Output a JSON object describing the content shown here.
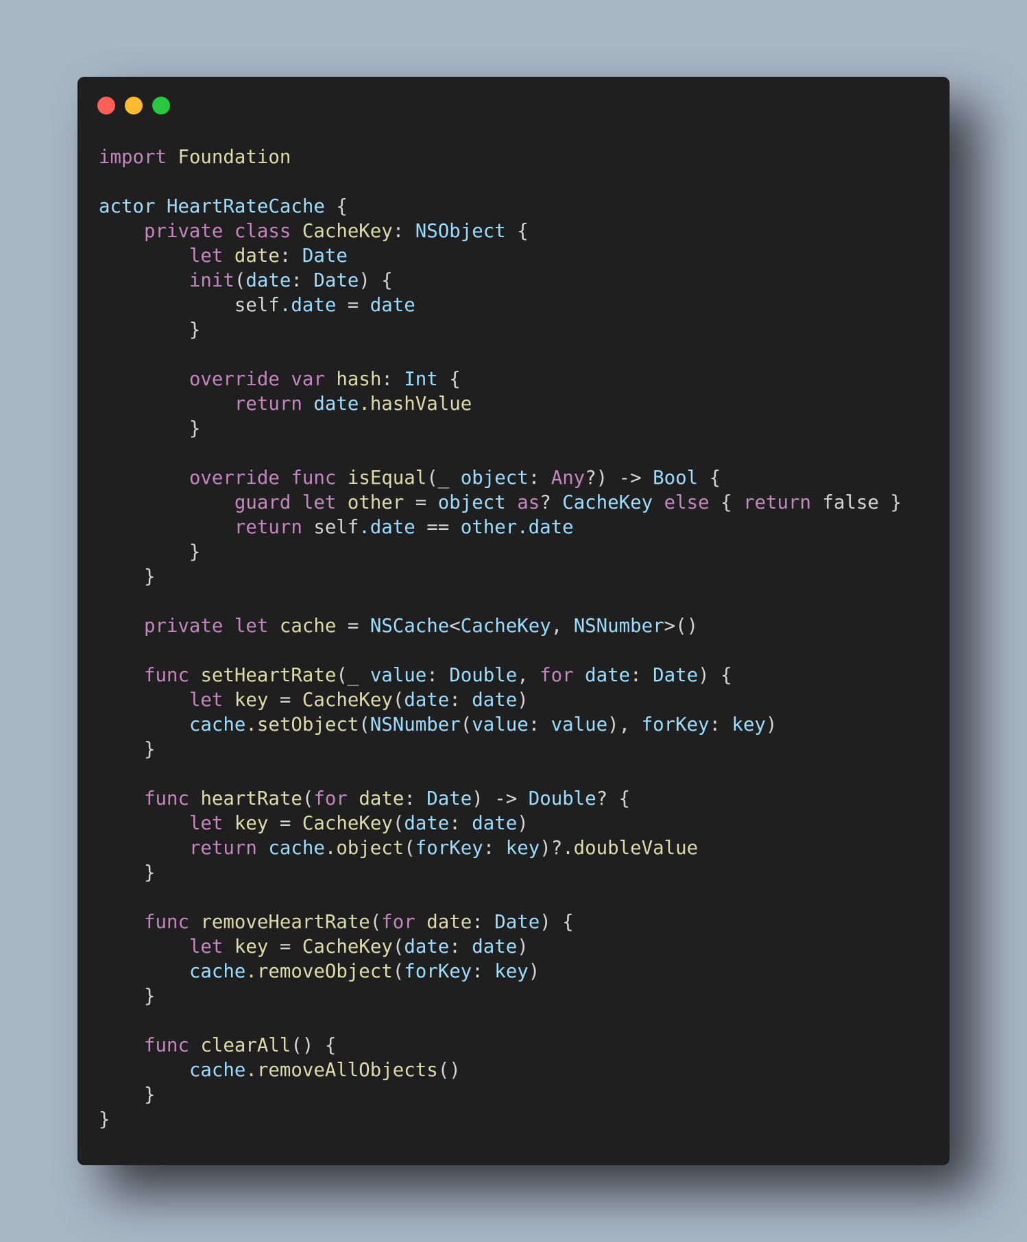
{
  "colors": {
    "background": "#a9b6c4",
    "window_background": "#1f1f1f",
    "close_button": "#ff5f57",
    "minimize_button": "#febc2e",
    "zoom_button": "#28c840",
    "keyword": "#c586c0",
    "type": "#9cdcfe",
    "function": "#dcdcaa",
    "identifier": "#9cdcfe",
    "punctuation": "#d4d4d4"
  },
  "code_lines": [
    [
      [
        "kw",
        "import"
      ],
      [
        "p",
        " "
      ],
      [
        "fn",
        "Foundation"
      ]
    ],
    [],
    [
      [
        "type",
        "actor"
      ],
      [
        "p",
        " "
      ],
      [
        "type",
        "HeartRateCache"
      ],
      [
        "p",
        " {"
      ]
    ],
    [
      [
        "p",
        "    "
      ],
      [
        "kw",
        "private"
      ],
      [
        "p",
        " "
      ],
      [
        "kw",
        "class"
      ],
      [
        "p",
        " "
      ],
      [
        "fn",
        "CacheKey"
      ],
      [
        "p",
        ": "
      ],
      [
        "type",
        "NSObject"
      ],
      [
        "p",
        " {"
      ]
    ],
    [
      [
        "p",
        "        "
      ],
      [
        "kw",
        "let"
      ],
      [
        "p",
        " "
      ],
      [
        "fn",
        "date"
      ],
      [
        "p",
        ": "
      ],
      [
        "type",
        "Date"
      ]
    ],
    [
      [
        "p",
        "        "
      ],
      [
        "kw",
        "init"
      ],
      [
        "p",
        "("
      ],
      [
        "id",
        "date"
      ],
      [
        "p",
        ": "
      ],
      [
        "type",
        "Date"
      ],
      [
        "p",
        ") {"
      ]
    ],
    [
      [
        "p",
        "            self"
      ],
      [
        "id",
        ".date"
      ],
      [
        "p",
        " = "
      ],
      [
        "id",
        "date"
      ]
    ],
    [
      [
        "p",
        "        }"
      ]
    ],
    [],
    [
      [
        "p",
        "        "
      ],
      [
        "kw",
        "override"
      ],
      [
        "p",
        " "
      ],
      [
        "kw",
        "var"
      ],
      [
        "p",
        " "
      ],
      [
        "fn",
        "hash"
      ],
      [
        "p",
        ": "
      ],
      [
        "type",
        "Int"
      ],
      [
        "p",
        " {"
      ]
    ],
    [
      [
        "p",
        "            "
      ],
      [
        "kw",
        "return"
      ],
      [
        "p",
        " "
      ],
      [
        "id",
        "date"
      ],
      [
        "fn",
        ".hashValue"
      ]
    ],
    [
      [
        "p",
        "        }"
      ]
    ],
    [],
    [
      [
        "p",
        "        "
      ],
      [
        "kw",
        "override"
      ],
      [
        "p",
        " "
      ],
      [
        "kw",
        "func"
      ],
      [
        "p",
        " "
      ],
      [
        "fn",
        "isEqual"
      ],
      [
        "p",
        "(_ "
      ],
      [
        "id",
        "object"
      ],
      [
        "p",
        ": "
      ],
      [
        "kw",
        "Any"
      ],
      [
        "p",
        "?) -> "
      ],
      [
        "type",
        "Bool"
      ],
      [
        "p",
        " {"
      ]
    ],
    [
      [
        "p",
        "            "
      ],
      [
        "kw",
        "guard"
      ],
      [
        "p",
        " "
      ],
      [
        "kw",
        "let"
      ],
      [
        "p",
        " "
      ],
      [
        "fn",
        "other"
      ],
      [
        "p",
        " = "
      ],
      [
        "id",
        "object"
      ],
      [
        "p",
        " "
      ],
      [
        "kw",
        "as"
      ],
      [
        "p",
        "? "
      ],
      [
        "type",
        "CacheKey"
      ],
      [
        "p",
        " "
      ],
      [
        "kw",
        "else"
      ],
      [
        "p",
        " { "
      ],
      [
        "kw",
        "return"
      ],
      [
        "p",
        " false }"
      ]
    ],
    [
      [
        "p",
        "            "
      ],
      [
        "kw",
        "return"
      ],
      [
        "p",
        " self"
      ],
      [
        "id",
        ".date"
      ],
      [
        "p",
        " == "
      ],
      [
        "id",
        "other"
      ],
      [
        "id",
        ".date"
      ]
    ],
    [
      [
        "p",
        "        }"
      ]
    ],
    [
      [
        "p",
        "    }"
      ]
    ],
    [],
    [
      [
        "p",
        "    "
      ],
      [
        "kw",
        "private"
      ],
      [
        "p",
        " "
      ],
      [
        "kw",
        "let"
      ],
      [
        "p",
        " "
      ],
      [
        "fn",
        "cache"
      ],
      [
        "p",
        " = "
      ],
      [
        "type",
        "NSCache"
      ],
      [
        "p",
        "<"
      ],
      [
        "type",
        "CacheKey"
      ],
      [
        "p",
        ", "
      ],
      [
        "type",
        "NSNumber"
      ],
      [
        "p",
        ">()"
      ]
    ],
    [],
    [
      [
        "p",
        "    "
      ],
      [
        "kw",
        "func"
      ],
      [
        "p",
        " "
      ],
      [
        "fn",
        "setHeartRate"
      ],
      [
        "p",
        "(_ "
      ],
      [
        "id",
        "value"
      ],
      [
        "p",
        ": "
      ],
      [
        "type",
        "Double"
      ],
      [
        "p",
        ", "
      ],
      [
        "kw",
        "for"
      ],
      [
        "p",
        " "
      ],
      [
        "id",
        "date"
      ],
      [
        "p",
        ": "
      ],
      [
        "type",
        "Date"
      ],
      [
        "p",
        ") {"
      ]
    ],
    [
      [
        "p",
        "        "
      ],
      [
        "kw",
        "let"
      ],
      [
        "p",
        " "
      ],
      [
        "fn",
        "key"
      ],
      [
        "p",
        " = "
      ],
      [
        "fn",
        "CacheKey"
      ],
      [
        "p",
        "("
      ],
      [
        "id",
        "date"
      ],
      [
        "p",
        ": "
      ],
      [
        "id",
        "date"
      ],
      [
        "p",
        ")"
      ]
    ],
    [
      [
        "p",
        "        "
      ],
      [
        "id",
        "cache"
      ],
      [
        "fn",
        ".setObject"
      ],
      [
        "p",
        "("
      ],
      [
        "type",
        "NSNumber"
      ],
      [
        "p",
        "("
      ],
      [
        "id",
        "value"
      ],
      [
        "p",
        ": "
      ],
      [
        "id",
        "value"
      ],
      [
        "p",
        "), "
      ],
      [
        "id",
        "forKey"
      ],
      [
        "p",
        ": "
      ],
      [
        "id",
        "key"
      ],
      [
        "p",
        ")"
      ]
    ],
    [
      [
        "p",
        "    }"
      ]
    ],
    [],
    [
      [
        "p",
        "    "
      ],
      [
        "kw",
        "func"
      ],
      [
        "p",
        " "
      ],
      [
        "fn",
        "heartRate"
      ],
      [
        "p",
        "("
      ],
      [
        "kw",
        "for"
      ],
      [
        "p",
        " "
      ],
      [
        "fn",
        "date"
      ],
      [
        "p",
        ": "
      ],
      [
        "type",
        "Date"
      ],
      [
        "p",
        ") -> "
      ],
      [
        "type",
        "Double"
      ],
      [
        "p",
        "? {"
      ]
    ],
    [
      [
        "p",
        "        "
      ],
      [
        "kw",
        "let"
      ],
      [
        "p",
        " "
      ],
      [
        "fn",
        "key"
      ],
      [
        "p",
        " = "
      ],
      [
        "fn",
        "CacheKey"
      ],
      [
        "p",
        "("
      ],
      [
        "id",
        "date"
      ],
      [
        "p",
        ": "
      ],
      [
        "id",
        "date"
      ],
      [
        "p",
        ")"
      ]
    ],
    [
      [
        "p",
        "        "
      ],
      [
        "kw",
        "return"
      ],
      [
        "p",
        " "
      ],
      [
        "id",
        "cache"
      ],
      [
        "fn",
        ".object"
      ],
      [
        "p",
        "("
      ],
      [
        "id",
        "forKey"
      ],
      [
        "p",
        ": "
      ],
      [
        "id",
        "key"
      ],
      [
        "p",
        ")?"
      ],
      [
        "fn",
        ".doubleValue"
      ]
    ],
    [
      [
        "p",
        "    }"
      ]
    ],
    [],
    [
      [
        "p",
        "    "
      ],
      [
        "kw",
        "func"
      ],
      [
        "p",
        " "
      ],
      [
        "fn",
        "removeHeartRate"
      ],
      [
        "p",
        "("
      ],
      [
        "kw",
        "for"
      ],
      [
        "p",
        " "
      ],
      [
        "fn",
        "date"
      ],
      [
        "p",
        ": "
      ],
      [
        "type",
        "Date"
      ],
      [
        "p",
        ") {"
      ]
    ],
    [
      [
        "p",
        "        "
      ],
      [
        "kw",
        "let"
      ],
      [
        "p",
        " "
      ],
      [
        "fn",
        "key"
      ],
      [
        "p",
        " = "
      ],
      [
        "fn",
        "CacheKey"
      ],
      [
        "p",
        "("
      ],
      [
        "id",
        "date"
      ],
      [
        "p",
        ": "
      ],
      [
        "id",
        "date"
      ],
      [
        "p",
        ")"
      ]
    ],
    [
      [
        "p",
        "        "
      ],
      [
        "id",
        "cache"
      ],
      [
        "fn",
        ".removeObject"
      ],
      [
        "p",
        "("
      ],
      [
        "id",
        "forKey"
      ],
      [
        "p",
        ": "
      ],
      [
        "id",
        "key"
      ],
      [
        "p",
        ")"
      ]
    ],
    [
      [
        "p",
        "    }"
      ]
    ],
    [],
    [
      [
        "p",
        "    "
      ],
      [
        "kw",
        "func"
      ],
      [
        "p",
        " "
      ],
      [
        "fn",
        "clearAll"
      ],
      [
        "p",
        "() {"
      ]
    ],
    [
      [
        "p",
        "        "
      ],
      [
        "id",
        "cache"
      ],
      [
        "fn",
        ".removeAllObjects"
      ],
      [
        "p",
        "()"
      ]
    ],
    [
      [
        "p",
        "    }"
      ]
    ],
    [
      [
        "p",
        "}"
      ]
    ]
  ]
}
